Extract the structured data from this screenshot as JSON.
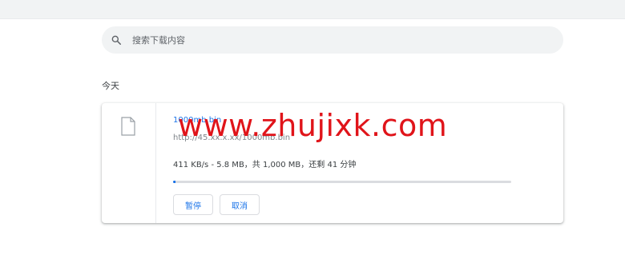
{
  "search": {
    "placeholder": "搜索下载内容",
    "icon": "search-icon"
  },
  "section": {
    "label": "今天"
  },
  "download": {
    "file_icon": "file-icon",
    "file_name": "1000mb.bin",
    "url": "http://45.xx.x.xx/1000mb.bin",
    "status": "411 KB/s - 5.8 MB，共 1,000 MB，还剩 41 分钟",
    "progress": 0.006,
    "pause_label": "暂停",
    "cancel_label": "取消"
  },
  "watermark": {
    "text": "www.zhujixk.com"
  },
  "colors": {
    "accent": "#1a73e8",
    "watermark": "#e0141a",
    "search_bg": "#f1f3f4"
  }
}
